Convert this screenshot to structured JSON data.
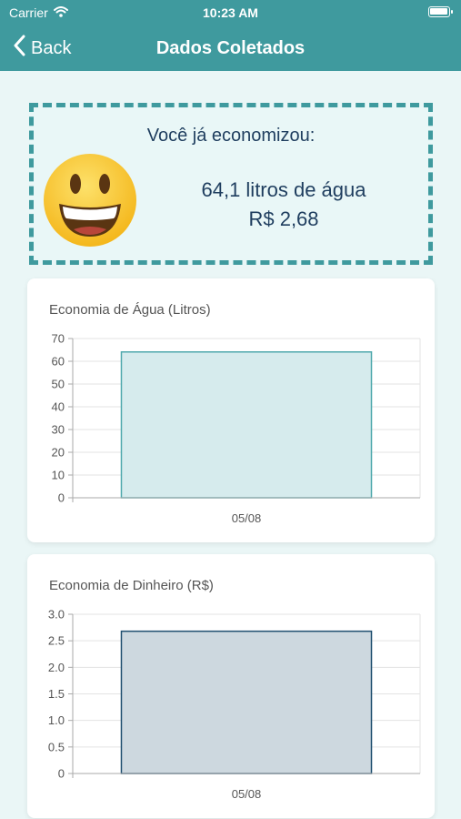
{
  "status_bar": {
    "carrier": "Carrier",
    "time": "10:23 AM",
    "battery_level": 1.0
  },
  "nav": {
    "back_label": "Back",
    "title": "Dados Coletados"
  },
  "summary": {
    "headline": "Você já economizou:",
    "water": "64,1 litros de água",
    "money": "R$ 2,68",
    "icon": "smiley-icon"
  },
  "chart_data": [
    {
      "type": "bar",
      "title": "Economia de Água (Litros)",
      "categories": [
        "05/08"
      ],
      "values": [
        64.1
      ],
      "ylim": [
        0,
        70
      ],
      "yticks": [
        "0",
        "10",
        "20",
        "30",
        "40",
        "50",
        "60",
        "70"
      ],
      "grid": true,
      "fill": "#d6ebed",
      "stroke": "#4fa9ad"
    },
    {
      "type": "bar",
      "title": "Economia de Dinheiro (R$)",
      "categories": [
        "05/08"
      ],
      "values": [
        2.68
      ],
      "ylim": [
        0,
        3
      ],
      "yticks": [
        "0",
        "0.5",
        "1.0",
        "1.5",
        "2.0",
        "2.5",
        "3.0"
      ],
      "grid": true,
      "fill": "#cdd8df",
      "stroke": "#1f4f6f"
    }
  ]
}
